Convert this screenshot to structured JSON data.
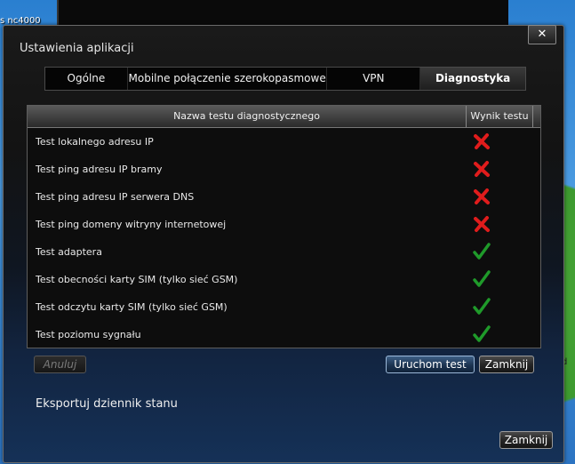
{
  "desktop": {
    "text": "s nc4000",
    "right_text": "d"
  },
  "window": {
    "title": "Ustawienia aplikacji",
    "close_glyph": "✕"
  },
  "tabs": [
    {
      "label": "Ogólne",
      "active": false
    },
    {
      "label": "Mobilne połączenie szerokopasmowe",
      "active": false
    },
    {
      "label": "VPN",
      "active": false
    },
    {
      "label": "Diagnostyka",
      "active": true
    }
  ],
  "table": {
    "headers": {
      "name": "Nazwa testu diagnostycznego",
      "result": "Wynik testu"
    },
    "rows": [
      {
        "name": "Test lokalnego adresu IP",
        "result": "fail"
      },
      {
        "name": "Test ping adresu IP bramy",
        "result": "fail"
      },
      {
        "name": "Test ping adresu IP serwera DNS",
        "result": "fail"
      },
      {
        "name": "Test ping domeny witryny internetowej",
        "result": "fail"
      },
      {
        "name": "Test adaptera",
        "result": "pass"
      },
      {
        "name": "Test obecności karty SIM (tylko sieć GSM)",
        "result": "pass"
      },
      {
        "name": "Test odczytu karty SIM (tylko sieć GSM)",
        "result": "pass"
      },
      {
        "name": "Test poziomu sygnału",
        "result": "pass"
      }
    ]
  },
  "buttons": {
    "cancel": "Anuluj",
    "run_test": "Uruchom test",
    "close_inner": "Zamknij",
    "close_bottom": "Zamknij"
  },
  "export_link": "Eksportuj dziennik stanu",
  "colors": {
    "fail": "#e01c1c",
    "pass": "#1f9a2a",
    "accent": "#3d5f86"
  }
}
